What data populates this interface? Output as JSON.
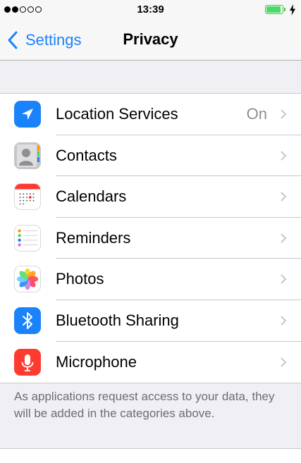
{
  "status_bar": {
    "time": "13:39",
    "signal_bars_filled": 2,
    "signal_bars_total": 5,
    "battery_level": 0.9,
    "battery_color": "#4cd964",
    "charging": true
  },
  "nav": {
    "back_label": "Settings",
    "title": "Privacy",
    "accent_color": "#1a82fb"
  },
  "privacy_items": [
    {
      "label": "Location Services",
      "value": "On",
      "icon": "location-arrow-icon",
      "icon_color": "#1a82fb"
    },
    {
      "label": "Contacts",
      "value": "",
      "icon": "contacts-icon",
      "icon_color": "#8e8e93"
    },
    {
      "label": "Calendars",
      "value": "",
      "icon": "calendar-icon",
      "icon_color": "#ff3b30"
    },
    {
      "label": "Reminders",
      "value": "",
      "icon": "reminders-icon",
      "icon_color": "#ffffff"
    },
    {
      "label": "Photos",
      "value": "",
      "icon": "photos-icon",
      "icon_color": "#ffffff"
    },
    {
      "label": "Bluetooth Sharing",
      "value": "",
      "icon": "bluetooth-icon",
      "icon_color": "#1a82fb"
    },
    {
      "label": "Microphone",
      "value": "",
      "icon": "microphone-icon",
      "icon_color": "#ff3b30"
    }
  ],
  "footer_note": "As applications request access to your data, they will be added in the categories above."
}
